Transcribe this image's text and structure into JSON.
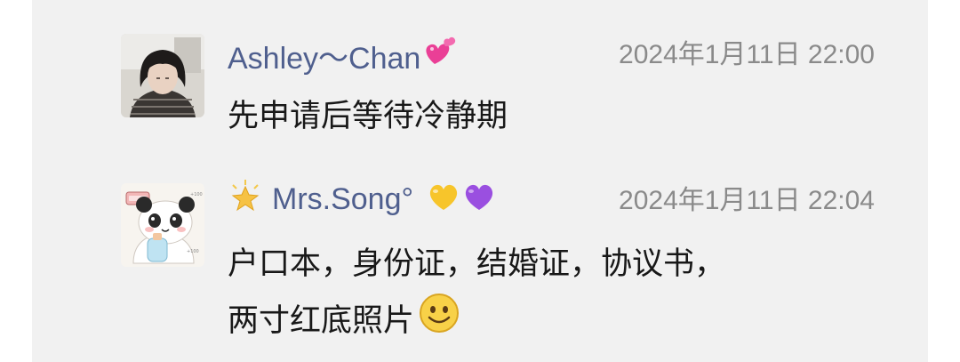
{
  "messages": [
    {
      "sender": "Ashley～Chan",
      "sender_emoji": "heart-icon",
      "time": "2024年1月11日 22:00",
      "text": "先申请后等待冷静期"
    },
    {
      "sender_prefix_emoji": "star-icon",
      "sender": "Mrs.Song°",
      "sender_emojis": [
        "yellow-heart-icon",
        "purple-heart-icon"
      ],
      "time": "2024年1月11日 22:04",
      "text_line1": "户口本，身份证，结婚证，协议书，",
      "text_line2": "两寸红底照片",
      "text_emoji": "smile-icon"
    }
  ],
  "colors": {
    "background": "#f1f1f1",
    "sender_name": "#4f5f8e",
    "timestamp": "#8a8a8a",
    "message_text": "#181818"
  }
}
